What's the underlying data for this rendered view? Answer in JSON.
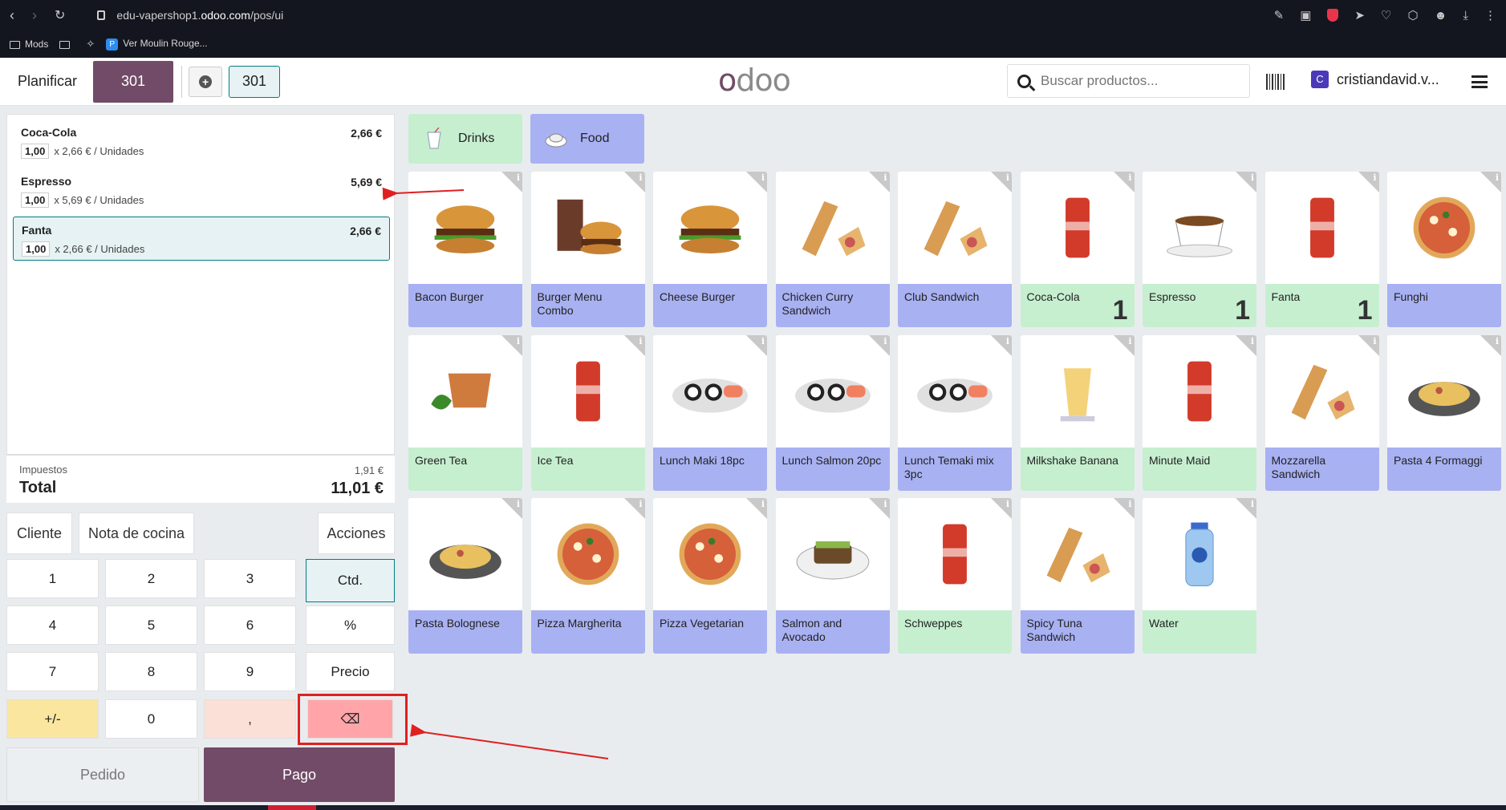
{
  "browser": {
    "url_prefix": "edu-vapershop1.",
    "url_domain": "odoo.com",
    "url_path": "/pos/ui",
    "bookmarks": [
      {
        "label": "Mods"
      },
      {
        "label": "Ver Moulin Rouge..."
      }
    ]
  },
  "header": {
    "plan_label": "Planificar",
    "active_table": "301",
    "table_tab": "301",
    "logo_o": "o",
    "logo_rest": "doo",
    "search_placeholder": "Buscar productos...",
    "user_initial": "C",
    "user_name": "cristiandavid.v..."
  },
  "order": {
    "lines": [
      {
        "name": "Coca-Cola",
        "price": "2,66 €",
        "qty": "1,00",
        "unit": "x 2,66 € / Unidades"
      },
      {
        "name": "Espresso",
        "price": "5,69 €",
        "qty": "1,00",
        "unit": "x 5,69 € / Unidades"
      },
      {
        "name": "Fanta",
        "price": "2,66 €",
        "qty": "1,00",
        "unit": "x 2,66 € / Unidades"
      }
    ],
    "tax_label": "Impuestos",
    "tax_value": "1,91 €",
    "total_label": "Total",
    "total_value": "11,01 €"
  },
  "actions": {
    "customer": "Cliente",
    "kitchen_note": "Nota de cocina",
    "actions": "Acciones"
  },
  "numpad": {
    "keys": [
      "1",
      "2",
      "3",
      "Ctd.",
      "4",
      "5",
      "6",
      "%",
      "7",
      "8",
      "9",
      "Precio",
      "+/-",
      "0",
      ",",
      "⌫"
    ]
  },
  "footer": {
    "order_label": "Pedido",
    "pay_label": "Pago"
  },
  "categories": [
    {
      "label": "Drinks",
      "color": "#c6efd0"
    },
    {
      "label": "Food",
      "color": "#a8b1f2"
    }
  ],
  "products": [
    {
      "name": "Bacon Burger",
      "type": "food",
      "count": ""
    },
    {
      "name": "Burger Menu Combo",
      "type": "food",
      "count": ""
    },
    {
      "name": "Cheese Burger",
      "type": "food",
      "count": ""
    },
    {
      "name": "Chicken Curry Sandwich",
      "type": "food",
      "count": ""
    },
    {
      "name": "Club Sandwich",
      "type": "food",
      "count": ""
    },
    {
      "name": "Coca-Cola",
      "type": "drink",
      "count": "1"
    },
    {
      "name": "Espresso",
      "type": "drink",
      "count": "1"
    },
    {
      "name": "Fanta",
      "type": "drink",
      "count": "1"
    },
    {
      "name": "Funghi",
      "type": "food",
      "count": ""
    },
    {
      "name": "Green Tea",
      "type": "drink",
      "count": ""
    },
    {
      "name": "Ice Tea",
      "type": "drink",
      "count": ""
    },
    {
      "name": "Lunch Maki 18pc",
      "type": "food",
      "count": ""
    },
    {
      "name": "Lunch Salmon 20pc",
      "type": "food",
      "count": ""
    },
    {
      "name": "Lunch Temaki mix 3pc",
      "type": "food",
      "count": ""
    },
    {
      "name": "Milkshake Banana",
      "type": "drink",
      "count": ""
    },
    {
      "name": "Minute Maid",
      "type": "drink",
      "count": ""
    },
    {
      "name": "Mozzarella Sandwich",
      "type": "food",
      "count": ""
    },
    {
      "name": "Pasta 4 Formaggi",
      "type": "food",
      "count": ""
    },
    {
      "name": "Pasta Bolognese",
      "type": "food",
      "count": ""
    },
    {
      "name": "Pizza Margherita",
      "type": "food",
      "count": ""
    },
    {
      "name": "Pizza Vegetarian",
      "type": "food",
      "count": ""
    },
    {
      "name": "Salmon and Avocado",
      "type": "food",
      "count": ""
    },
    {
      "name": "Schweppes",
      "type": "drink",
      "count": ""
    },
    {
      "name": "Spicy Tuna Sandwich",
      "type": "food",
      "count": ""
    },
    {
      "name": "Water",
      "type": "drink",
      "count": ""
    }
  ],
  "colors": {
    "brand": "#714b67",
    "selected": "#017e84",
    "food": "#a8b1f2",
    "drink": "#c6efd0",
    "annotation": "#e02020"
  }
}
